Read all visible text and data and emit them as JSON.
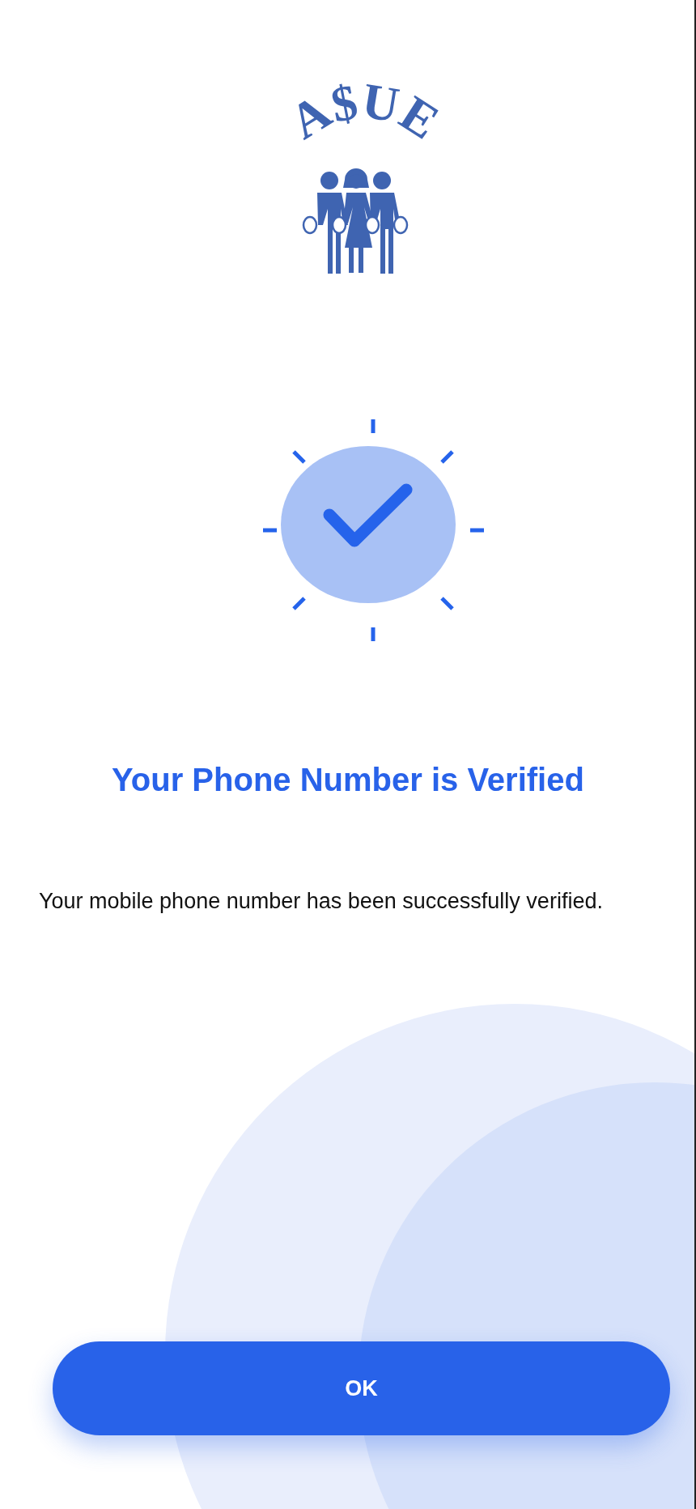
{
  "logo": {
    "text": "A$UE"
  },
  "status_icon": {
    "kind": "success"
  },
  "title": "Your Phone Number is Verified",
  "message": "Your mobile phone number has been successfully verified.",
  "button": {
    "label": "OK"
  }
}
